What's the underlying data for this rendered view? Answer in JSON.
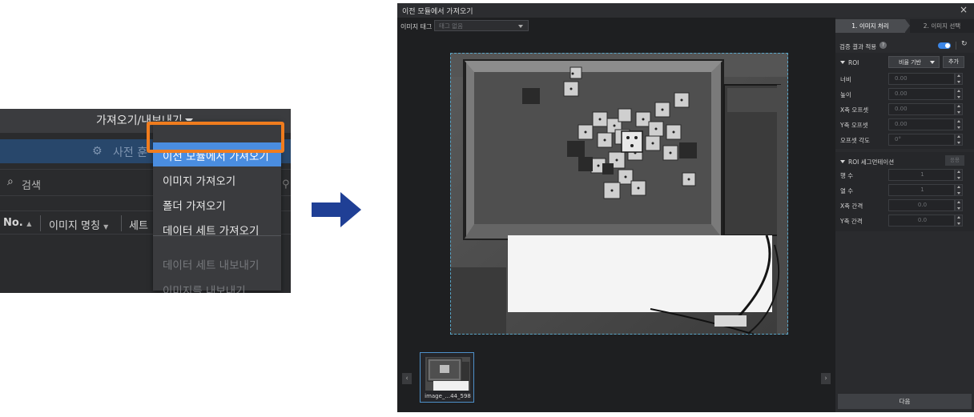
{
  "menu_crop": {
    "topbar_title": "가져오기/내보내기",
    "bluebar_label": "사전 훈",
    "search_placeholder": "검색",
    "columns": [
      "No.",
      "이미지 명칭",
      "세트"
    ],
    "dropdown_items": [
      {
        "label": "이전 모듈에서 가져오기",
        "state": "highlighted"
      },
      {
        "label": "이미지 가져오기",
        "state": "enabled"
      },
      {
        "label": "폴더 가져오기",
        "state": "enabled"
      },
      {
        "label": "데이터 세트 가져오기",
        "state": "enabled"
      },
      {
        "label": "데이터 세트 내보내기",
        "state": "disabled"
      },
      {
        "label": "이미지를 내보내기",
        "state": "disabled"
      }
    ]
  },
  "dialog": {
    "title": "이전 모듈에서 가져오기",
    "image_tag_label": "이미지 태그",
    "image_tag_value": "태그 없음",
    "steps": [
      "1. 이미지 처리",
      "2. 이미지 선택"
    ],
    "verify_label": "검증 결과 적용",
    "verify_enabled": true,
    "roi": {
      "header": "ROI",
      "mode": "비율 기반",
      "add_label": "추가",
      "fields": [
        {
          "label": "너비",
          "value": "0.00"
        },
        {
          "label": "높이",
          "value": "0.00"
        },
        {
          "label": "X축 오프셋",
          "value": "0.00"
        },
        {
          "label": "Y축 오프셋",
          "value": "0.00"
        },
        {
          "label": "오프셋 각도",
          "value": "0°"
        }
      ]
    },
    "segmentation": {
      "header": "ROI 세그먼테이션",
      "apply_label": "응용",
      "fields": [
        {
          "label": "행 수",
          "value": "1"
        },
        {
          "label": "열 수",
          "value": "1"
        },
        {
          "label": "X축 간격",
          "value": "0.0"
        },
        {
          "label": "Y축 간격",
          "value": "0.0"
        }
      ]
    },
    "thumbnail_caption": "image_...44_598",
    "next_label": "다음"
  },
  "colors": {
    "accent_blue": "#4a8de0",
    "highlight_orange": "#f07c1e",
    "arrow_blue": "#1f3f95",
    "roi_frame": "#5aa6c8"
  }
}
